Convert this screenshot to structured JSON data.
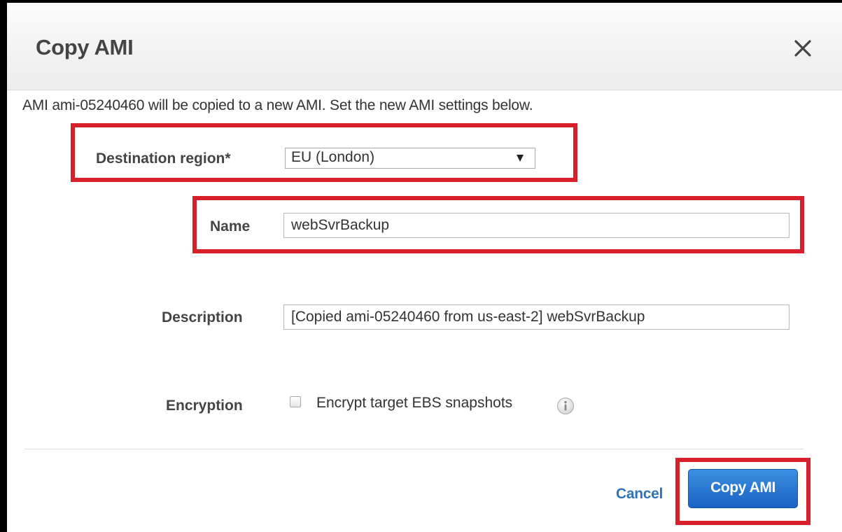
{
  "dialog": {
    "title": "Copy AMI",
    "close_icon": "close-icon",
    "intro": "AMI ami-05240460 will be copied to a new AMI. Set the new AMI settings below."
  },
  "form": {
    "destination_region": {
      "label": "Destination region*",
      "value": "EU (London)"
    },
    "name": {
      "label": "Name",
      "value": "webSvrBackup"
    },
    "description": {
      "label": "Description",
      "value": "[Copied ami-05240460 from us-east-2] webSvrBackup"
    },
    "encryption": {
      "label": "Encryption",
      "checkbox_label": "Encrypt target EBS snapshots",
      "checked": false,
      "info_icon": "info-icon"
    }
  },
  "footer": {
    "cancel_label": "Cancel",
    "submit_label": "Copy AMI"
  },
  "colors": {
    "highlight": "#d7202b",
    "primary_button": "#2a7bd6",
    "link": "#2f72b8"
  }
}
